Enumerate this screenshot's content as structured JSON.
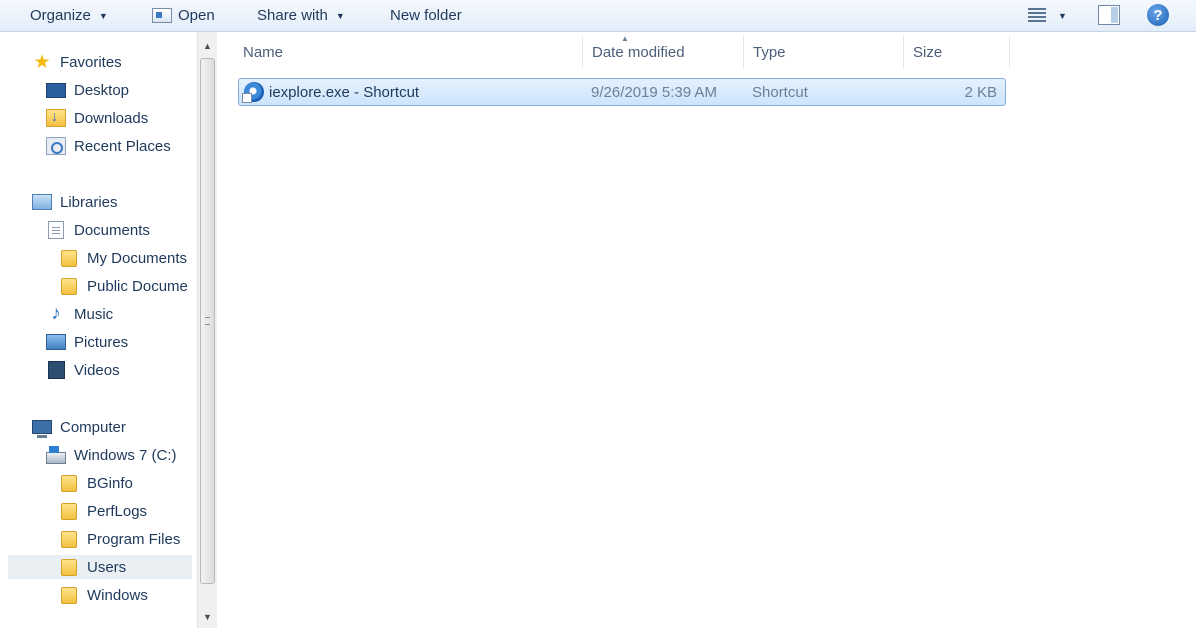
{
  "toolbar": {
    "organize": "Organize",
    "open": "Open",
    "share_with": "Share with",
    "new_folder": "New folder",
    "help": "?"
  },
  "nav": {
    "favorites": "Favorites",
    "desktop": "Desktop",
    "downloads": "Downloads",
    "recent_places": "Recent Places",
    "libraries": "Libraries",
    "documents": "Documents",
    "my_documents": "My Documents",
    "public_documents": "Public Docume",
    "music": "Music",
    "pictures": "Pictures",
    "videos": "Videos",
    "computer": "Computer",
    "windows7": "Windows 7 (C:)",
    "bginfo": "BGinfo",
    "perflogs": "PerfLogs",
    "program_files": "Program Files",
    "users": "Users",
    "windows": "Windows"
  },
  "columns": {
    "name": "Name",
    "date_modified": "Date modified",
    "type": "Type",
    "size": "Size"
  },
  "files": [
    {
      "name": "iexplore.exe - Shortcut",
      "date_modified": "9/26/2019 5:39 AM",
      "type": "Shortcut",
      "size": "2 KB"
    }
  ],
  "icons": {
    "favorites": "star-icon",
    "file": "internet-explorer-shortcut-icon",
    "help": "help-icon"
  }
}
